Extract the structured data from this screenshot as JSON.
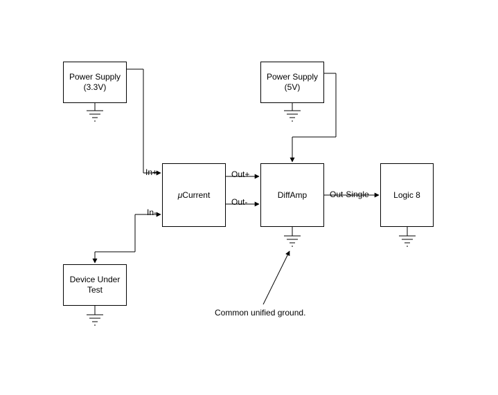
{
  "boxes": {
    "psu33": {
      "line1": "Power Supply",
      "line2": "(3.3V)"
    },
    "psu5": {
      "line1": "Power Supply",
      "line2": "(5V)"
    },
    "dut": {
      "line1": "Device Under",
      "line2": "Test"
    },
    "ucurrent": {
      "label_prefix": "μ",
      "label_rest": "Current"
    },
    "diffamp": {
      "label": "DiffAmp"
    },
    "logic8": {
      "label": "Logic 8"
    }
  },
  "labels": {
    "in_plus": "In+",
    "in_minus": "In-",
    "out_plus": "Out+",
    "out_minus": "Out-",
    "out_single": "Out-Single",
    "common_ground": "Common unified ground."
  }
}
